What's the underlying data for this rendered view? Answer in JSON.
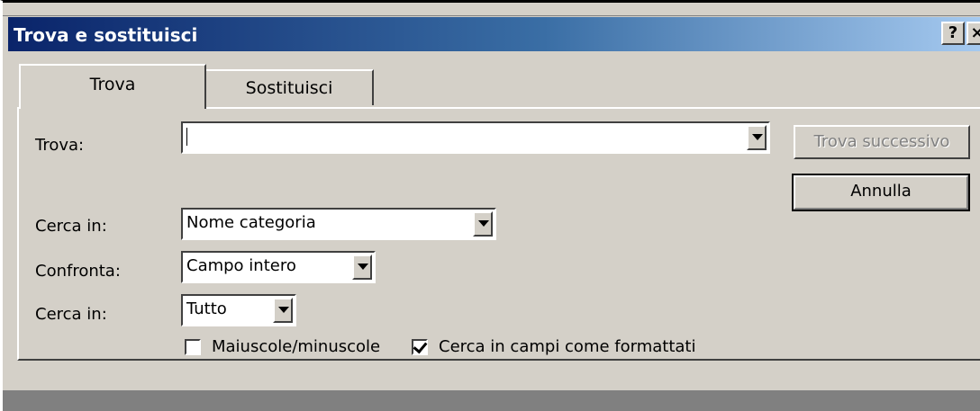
{
  "window": {
    "title": "Trova e sostituisci",
    "help_label": "?",
    "close_label": "×"
  },
  "tabs": [
    {
      "label": "Trova",
      "active": true
    },
    {
      "label": "Sostituisci",
      "active": false
    }
  ],
  "form": {
    "find_label": "Trova:",
    "find_value": "",
    "look_in_label": "Cerca in:",
    "look_in_value": "Nome categoria",
    "match_label": "Confronta:",
    "match_value": "Campo intero",
    "search_label": "Cerca in:",
    "search_value": "Tutto",
    "match_case_label": "Maiuscole/minuscole",
    "match_case_checked": false,
    "formatted_label": "Cerca in campi come formattati",
    "formatted_checked": true
  },
  "buttons": {
    "find_next": "Trova successivo",
    "cancel": "Annulla"
  },
  "colors": {
    "title_bar_start": "#0a246a",
    "title_bar_end": "#a6caf0",
    "dialog_background": "#d4d0c8"
  }
}
